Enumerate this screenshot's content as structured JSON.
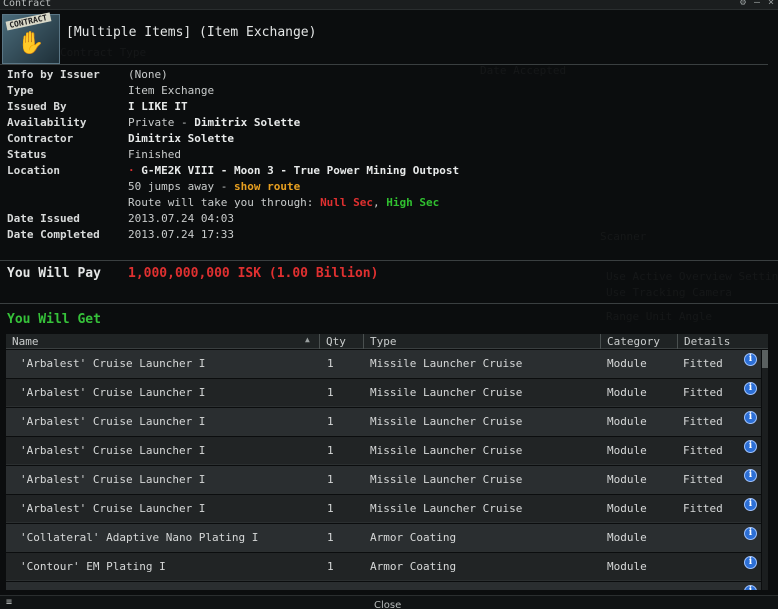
{
  "window": {
    "title": "Contract",
    "controls": [
      "⚙",
      "–",
      "×"
    ]
  },
  "header": {
    "icon_badge": "CONTRACT",
    "title": "[Multiple Items] (Item Exchange)"
  },
  "info": [
    {
      "label": "Info by Issuer",
      "value": "(None)"
    },
    {
      "label": "Type",
      "value": "Item Exchange"
    },
    {
      "label": "Issued By",
      "value": "I LIKE IT"
    },
    {
      "label": "Availability",
      "value_prefix": "Private - ",
      "value": "Dimitrix Solette"
    },
    {
      "label": "Contractor",
      "value": "Dimitrix Solette"
    },
    {
      "label": "Status",
      "value": "Finished"
    },
    {
      "label": "Location",
      "value": "G-ME2K VIII - Moon 3 - True Power Mining Outpost"
    },
    {
      "label": "",
      "value_prefix": "50 jumps away - ",
      "value": "show route"
    },
    {
      "label": "",
      "value_prefix": "Route will take you through: ",
      "value": "Null Sec",
      "value_sep": ", ",
      "value2": "High Sec"
    },
    {
      "label": "Date Issued",
      "value": "2013.07.24 04:03"
    },
    {
      "label": "Date Completed",
      "value": "2013.07.24 17:33"
    }
  ],
  "pay": {
    "label": "You Will Pay",
    "value": "1,000,000,000 ISK (1.00 Billion)"
  },
  "get": {
    "label": "You Will Get"
  },
  "table": {
    "columns": [
      "Name",
      "Qty",
      "Type",
      "Category",
      "Details"
    ],
    "rows": [
      {
        "name": "'Arbalest' Cruise Launcher I",
        "qty": "1",
        "type": "Missile Launcher Cruise",
        "category": "Module",
        "details": "Fitted"
      },
      {
        "name": "'Arbalest' Cruise Launcher I",
        "qty": "1",
        "type": "Missile Launcher Cruise",
        "category": "Module",
        "details": "Fitted"
      },
      {
        "name": "'Arbalest' Cruise Launcher I",
        "qty": "1",
        "type": "Missile Launcher Cruise",
        "category": "Module",
        "details": "Fitted"
      },
      {
        "name": "'Arbalest' Cruise Launcher I",
        "qty": "1",
        "type": "Missile Launcher Cruise",
        "category": "Module",
        "details": "Fitted"
      },
      {
        "name": "'Arbalest' Cruise Launcher I",
        "qty": "1",
        "type": "Missile Launcher Cruise",
        "category": "Module",
        "details": "Fitted"
      },
      {
        "name": "'Arbalest' Cruise Launcher I",
        "qty": "1",
        "type": "Missile Launcher Cruise",
        "category": "Module",
        "details": "Fitted"
      },
      {
        "name": "'Collateral' Adaptive Nano Plating I",
        "qty": "1",
        "type": "Armor Coating",
        "category": "Module",
        "details": ""
      },
      {
        "name": "'Contour' EM Plating I",
        "qty": "1",
        "type": "Armor Coating",
        "category": "Module",
        "details": ""
      },
      {
        "name": "",
        "qty": "",
        "type": "",
        "category": "",
        "details": ""
      }
    ]
  },
  "footer": {
    "menu_icon": "≡",
    "close_label": "Close"
  },
  "colors": {
    "pay": "#e03030",
    "get": "#36c23a",
    "show_route": "#e8a020",
    "null_sec": "#e03030",
    "high_sec": "#30c030",
    "location_dot": "#d93030"
  }
}
